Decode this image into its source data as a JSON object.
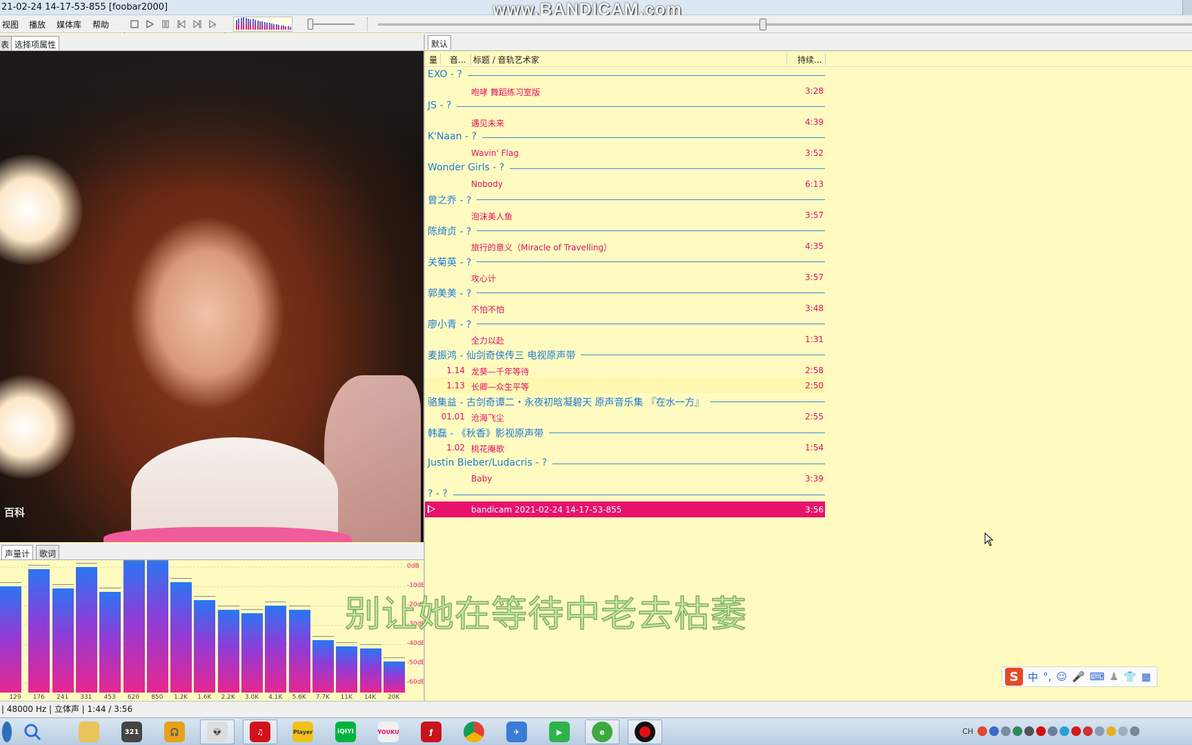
{
  "window": {
    "title": "21-02-24 14-17-53-855  [foobar2000]",
    "watermark": "www.BANDICAM.com"
  },
  "menu": [
    "视图",
    "播放",
    "媒体库",
    "帮助"
  ],
  "left_tabs": [
    "表",
    "选择项属性"
  ],
  "album_art": {
    "logo_text": "百科"
  },
  "vis_tabs": [
    "声量计",
    "歌词"
  ],
  "spectrum": {
    "db_labels": [
      "0dB",
      "-10dB",
      "-20dB",
      "-30dB",
      "-40dB",
      "-50dB",
      "-60dB"
    ],
    "freq_labels": [
      "129",
      "176",
      "241",
      "331",
      "453",
      "620",
      "850",
      "1.2K",
      "1.6K",
      "2.2K",
      "3.0K",
      "4.1K",
      "5.6K",
      "7.7K",
      "11K",
      "14K",
      "20K"
    ],
    "levels_db": [
      -10,
      -1,
      -11,
      0,
      -13,
      7,
      6,
      -8,
      -17,
      -22,
      -24,
      -20,
      -22,
      -38,
      -41,
      -42,
      -49
    ]
  },
  "playlist": {
    "tab": "默认",
    "columns": {
      "track": "音...",
      "title": "标题 / 音轨艺术家",
      "duration": "持续..."
    },
    "rows": [
      {
        "type": "group",
        "text": "EXO - ?"
      },
      {
        "type": "track",
        "num": "",
        "title": "咆哮 舞蹈练习室版",
        "dur": "3:28"
      },
      {
        "type": "group",
        "text": "JS - ?"
      },
      {
        "type": "track",
        "num": "",
        "title": "遇见未来",
        "dur": "4:39"
      },
      {
        "type": "group",
        "text": "K'Naan - ?"
      },
      {
        "type": "track",
        "num": "",
        "title": "Wavin' Flag",
        "dur": "3:52"
      },
      {
        "type": "group",
        "text": "Wonder Girls - ?"
      },
      {
        "type": "track",
        "num": "",
        "title": "Nobody",
        "dur": "6:13"
      },
      {
        "type": "group",
        "text": "曾之乔 - ?"
      },
      {
        "type": "track",
        "num": "",
        "title": "泡沫美人鱼",
        "dur": "3:57"
      },
      {
        "type": "group",
        "text": "陈绮贞 - ?"
      },
      {
        "type": "track",
        "num": "",
        "title": "旅行的意义（Miracle of Travelling）",
        "dur": "4:35"
      },
      {
        "type": "group",
        "text": "关菊英 - ?"
      },
      {
        "type": "track",
        "num": "",
        "title": "攻心计",
        "dur": "3:57"
      },
      {
        "type": "group",
        "text": "郭美美 - ?"
      },
      {
        "type": "track",
        "num": "",
        "title": "不怕不怕",
        "dur": "3:48"
      },
      {
        "type": "group",
        "text": "廖小青 - ?"
      },
      {
        "type": "track",
        "num": "",
        "title": "全力以赴",
        "dur": "1:31"
      },
      {
        "type": "group",
        "text": "麦振鸿 - 仙剑奇侠传三 电视原声带"
      },
      {
        "type": "track",
        "num": "1.14",
        "title": "龙葵—千年等待",
        "dur": "2:58"
      },
      {
        "type": "track",
        "num": "1.13",
        "title": "长卿—众生平等",
        "dur": "2:50"
      },
      {
        "type": "group",
        "text": "骆集益 - 古剑奇谭二・永夜初晗凝碧天 原声音乐集 『在水一方』"
      },
      {
        "type": "track",
        "num": "01.01",
        "title": "沧海飞尘",
        "dur": "2:55"
      },
      {
        "type": "group",
        "text": "韩磊 - 《秋香》影视原声带"
      },
      {
        "type": "track",
        "num": "1.02",
        "title": "桃花庵歌",
        "dur": "1:54"
      },
      {
        "type": "group",
        "text": "Justin Bieber/Ludacris - ?"
      },
      {
        "type": "track",
        "num": "",
        "title": "Baby",
        "dur": "3:39"
      },
      {
        "type": "group",
        "text": "? - ?"
      },
      {
        "type": "track",
        "num": "",
        "title": "bandicam 2021-02-24 14-17-53-855",
        "dur": "3:56",
        "playing": true
      }
    ]
  },
  "lyrics": "别让她在等待中老去枯萎",
  "ime": {
    "logo": "S",
    "mode": "中",
    "punct": "°,"
  },
  "statusbar": "| 48000 Hz | 立体声 | 1:44 / 3:56",
  "tray": {
    "lang": "CH"
  },
  "colors": {
    "accent_pink": "#e8126d",
    "group_blue": "#1f7ad6",
    "playlist_bg": "#fffbc0"
  }
}
